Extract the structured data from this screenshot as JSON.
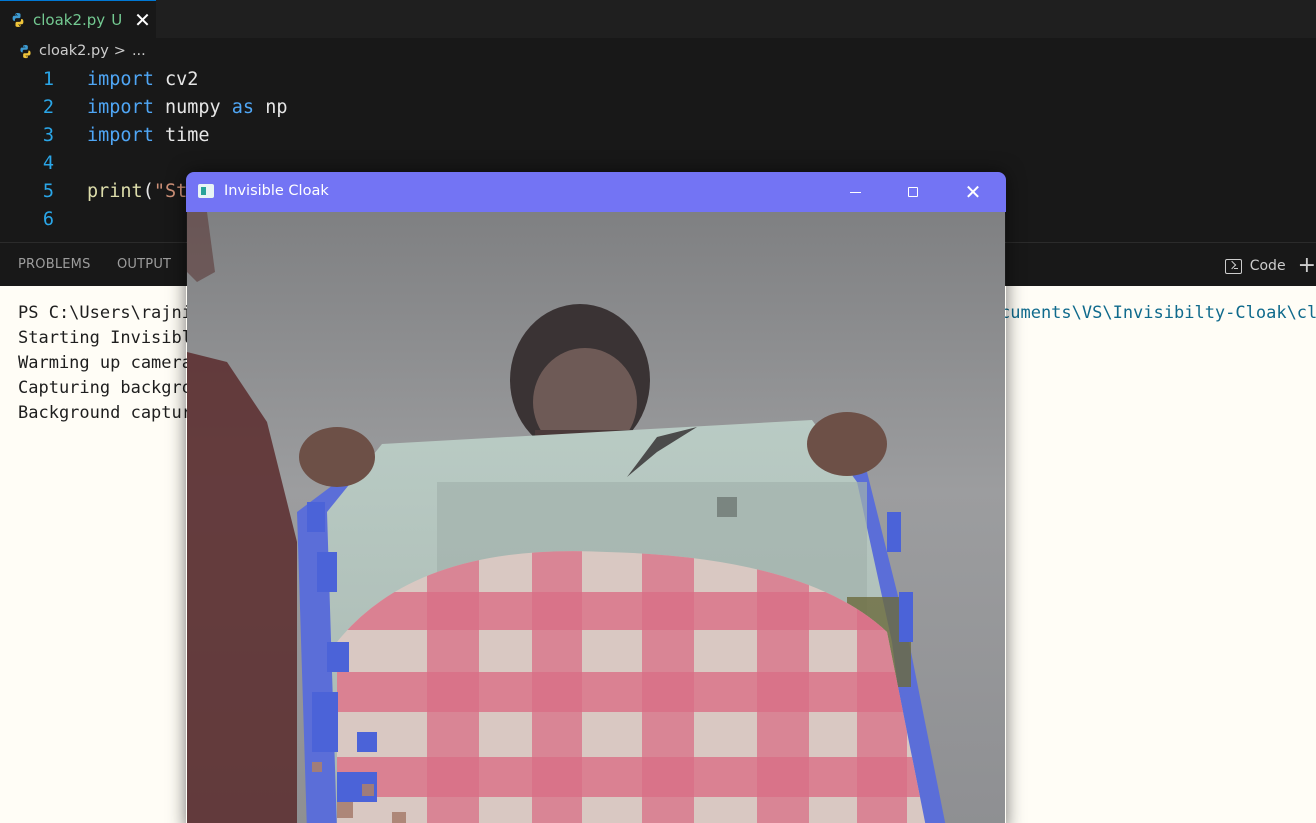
{
  "editor": {
    "tab": {
      "label": "cloak2.py",
      "badge": "U",
      "close": "✕"
    },
    "breadcrumb": {
      "file": "cloak2.py",
      "separator": ">",
      "more": "..."
    },
    "code_lines": [
      {
        "number": "1",
        "keyword": "import",
        "rest": " cv2"
      },
      {
        "number": "2",
        "keyword": "import",
        "rest": " numpy ",
        "keyword2": "as",
        "rest2": " np"
      },
      {
        "number": "3",
        "keyword": "import",
        "rest": " time"
      },
      {
        "number": "4"
      },
      {
        "number": "5",
        "fn": "print",
        "paren": "(",
        "string": "\"St"
      },
      {
        "number": "6"
      }
    ]
  },
  "panel": {
    "tabs": [
      "PROBLEMS",
      "OUTPUT"
    ],
    "terminal_label": "Code",
    "add_icon": "+"
  },
  "terminal": {
    "lines": [
      "PS C:\\Users\\rajni",
      "Starting Invisibl",
      "Warming up camera",
      "Capturing backgro",
      "Background captur"
    ],
    "path_tail": "cuments\\VS\\Invisibilty-Cloak\\cl"
  },
  "cv_window": {
    "title": "Invisible Cloak",
    "minimize": "minimize",
    "maximize": "maximize",
    "close": "✕"
  },
  "icons": {
    "python": "python-file-icon",
    "terminal": "terminal-icon",
    "app": "opencv-window-icon"
  },
  "colors": {
    "tab_text": "#73c991",
    "line_number": "#2aa6e8",
    "keyword": "#4fa6f5",
    "cv_titlebar": "#7374f4",
    "terminal_bg": "#fffdf6"
  }
}
